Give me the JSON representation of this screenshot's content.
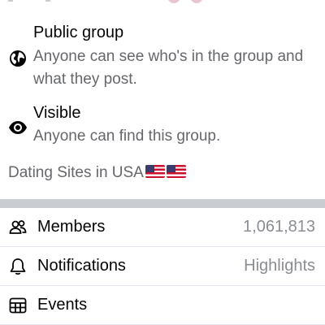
{
  "privacy": {
    "title": "Public group",
    "description": "Anyone can see who's in the group and what they post.",
    "icon": "globe-icon"
  },
  "visibility": {
    "title": "Visible",
    "description": "Anyone can find this group.",
    "icon": "eye-icon"
  },
  "group_tag": {
    "text": "Dating Sites in USA",
    "flags": [
      "us-flag",
      "us-flag"
    ]
  },
  "rows": [
    {
      "label": "Members",
      "value": "1,061,813",
      "icon": "members-icon"
    },
    {
      "label": "Notifications",
      "value": "Highlights",
      "icon": "bell-icon"
    },
    {
      "label": "Events",
      "value": "",
      "icon": "calendar-icon"
    }
  ],
  "colors": {
    "primary_text": "#050505",
    "secondary_text": "#65676b",
    "value_text": "#8a8d91",
    "divider": "#c9ccd1"
  }
}
